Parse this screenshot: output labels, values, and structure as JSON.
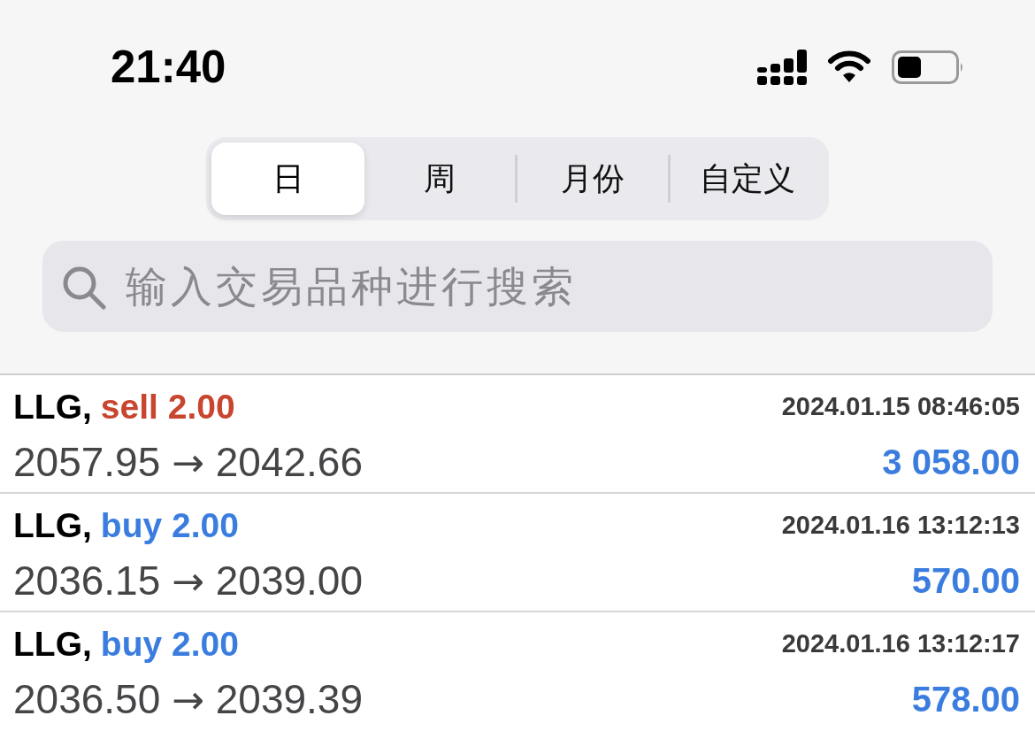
{
  "status_bar": {
    "time": "21:40"
  },
  "period_tabs": [
    {
      "label": "日",
      "selected": true
    },
    {
      "label": "周",
      "selected": false
    },
    {
      "label": "月份",
      "selected": false
    },
    {
      "label": "自定义",
      "selected": false
    }
  ],
  "search": {
    "placeholder": "输入交易品种进行搜索"
  },
  "trades": [
    {
      "symbol": "LLG,",
      "order": {
        "text": "sell 2.00",
        "color": "#c8452f"
      },
      "time": "2024.01.15 08:46:05",
      "prices": {
        "open": "2057.95",
        "arrow": "→",
        "close": "2042.66"
      },
      "profit": "3 058.00"
    },
    {
      "symbol": "LLG,",
      "order": {
        "text": "buy 2.00",
        "color": "#3a7ddf"
      },
      "time": "2024.01.16 13:12:13",
      "prices": {
        "open": "2036.15",
        "arrow": "→",
        "close": "2039.00"
      },
      "profit": "570.00"
    },
    {
      "symbol": "LLG,",
      "order": {
        "text": "buy 2.00",
        "color": "#3a7ddf"
      },
      "time": "2024.01.16 13:12:17",
      "prices": {
        "open": "2036.50",
        "arrow": "→",
        "close": "2039.39"
      },
      "profit": "578.00"
    }
  ]
}
